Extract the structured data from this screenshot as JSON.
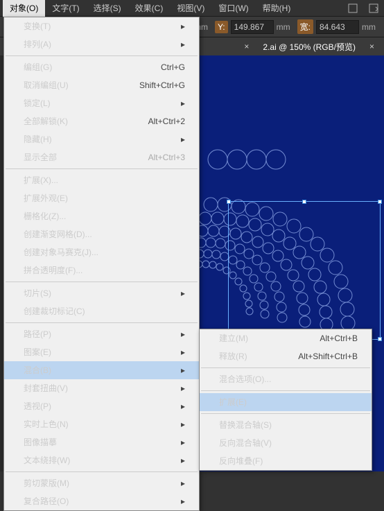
{
  "menubar": {
    "items": [
      "对象(O)",
      "文字(T)",
      "选择(S)",
      "效果(C)",
      "视图(V)",
      "窗口(W)",
      "帮助(H)"
    ]
  },
  "toolbar": {
    "x_unit": "mm",
    "y_label": "Y:",
    "y_value": "149.867",
    "y_unit": "mm",
    "w_label": "宽:",
    "w_value": "84.643",
    "w_unit": "mm"
  },
  "tabs": {
    "items": [
      "× ",
      "2.ai @ 150% (RGB/预览)",
      "×"
    ]
  },
  "menu": {
    "items": [
      {
        "label": "变换(T)",
        "arrow": true
      },
      {
        "label": "排列(A)",
        "arrow": true
      },
      {
        "sep": true
      },
      {
        "label": "编组(G)",
        "shortcut": "Ctrl+G"
      },
      {
        "label": "取消编组(U)",
        "shortcut": "Shift+Ctrl+G"
      },
      {
        "label": "锁定(L)",
        "arrow": true
      },
      {
        "label": "全部解锁(K)",
        "shortcut": "Alt+Ctrl+2"
      },
      {
        "label": "隐藏(H)",
        "arrow": true
      },
      {
        "label": "显示全部",
        "shortcut": "Alt+Ctrl+3",
        "disabled": true
      },
      {
        "sep": true
      },
      {
        "label": "扩展(X)..."
      },
      {
        "label": "扩展外观(E)",
        "disabled": true
      },
      {
        "label": "栅格化(Z)..."
      },
      {
        "label": "创建渐变网格(D)...",
        "disabled": true
      },
      {
        "label": "创建对象马赛克(J)...",
        "disabled": true
      },
      {
        "label": "拼合透明度(F)..."
      },
      {
        "sep": true
      },
      {
        "label": "切片(S)",
        "arrow": true
      },
      {
        "label": "创建裁切标记(C)"
      },
      {
        "sep": true
      },
      {
        "label": "路径(P)",
        "arrow": true
      },
      {
        "label": "图案(E)",
        "arrow": true
      },
      {
        "label": "混合(B)",
        "arrow": true,
        "hover": true
      },
      {
        "label": "封套扭曲(V)",
        "arrow": true
      },
      {
        "label": "透视(P)",
        "arrow": true
      },
      {
        "label": "实时上色(N)",
        "arrow": true
      },
      {
        "label": "图像描摹",
        "arrow": true
      },
      {
        "label": "文本绕排(W)",
        "arrow": true
      },
      {
        "sep": true
      },
      {
        "label": "剪切蒙版(M)",
        "arrow": true
      },
      {
        "label": "复合路径(O)",
        "arrow": true
      }
    ]
  },
  "submenu": {
    "items": [
      {
        "label": "建立(M)",
        "shortcut": "Alt+Ctrl+B"
      },
      {
        "label": "释放(R)",
        "shortcut": "Alt+Shift+Ctrl+B"
      },
      {
        "sep": true
      },
      {
        "label": "混合选项(O)..."
      },
      {
        "sep": true
      },
      {
        "label": "扩展(E)",
        "hover": true
      },
      {
        "sep": true
      },
      {
        "label": "替换混合轴(S)",
        "disabled": true
      },
      {
        "label": "反向混合轴(V)"
      },
      {
        "label": "反向堆叠(F)"
      }
    ]
  }
}
